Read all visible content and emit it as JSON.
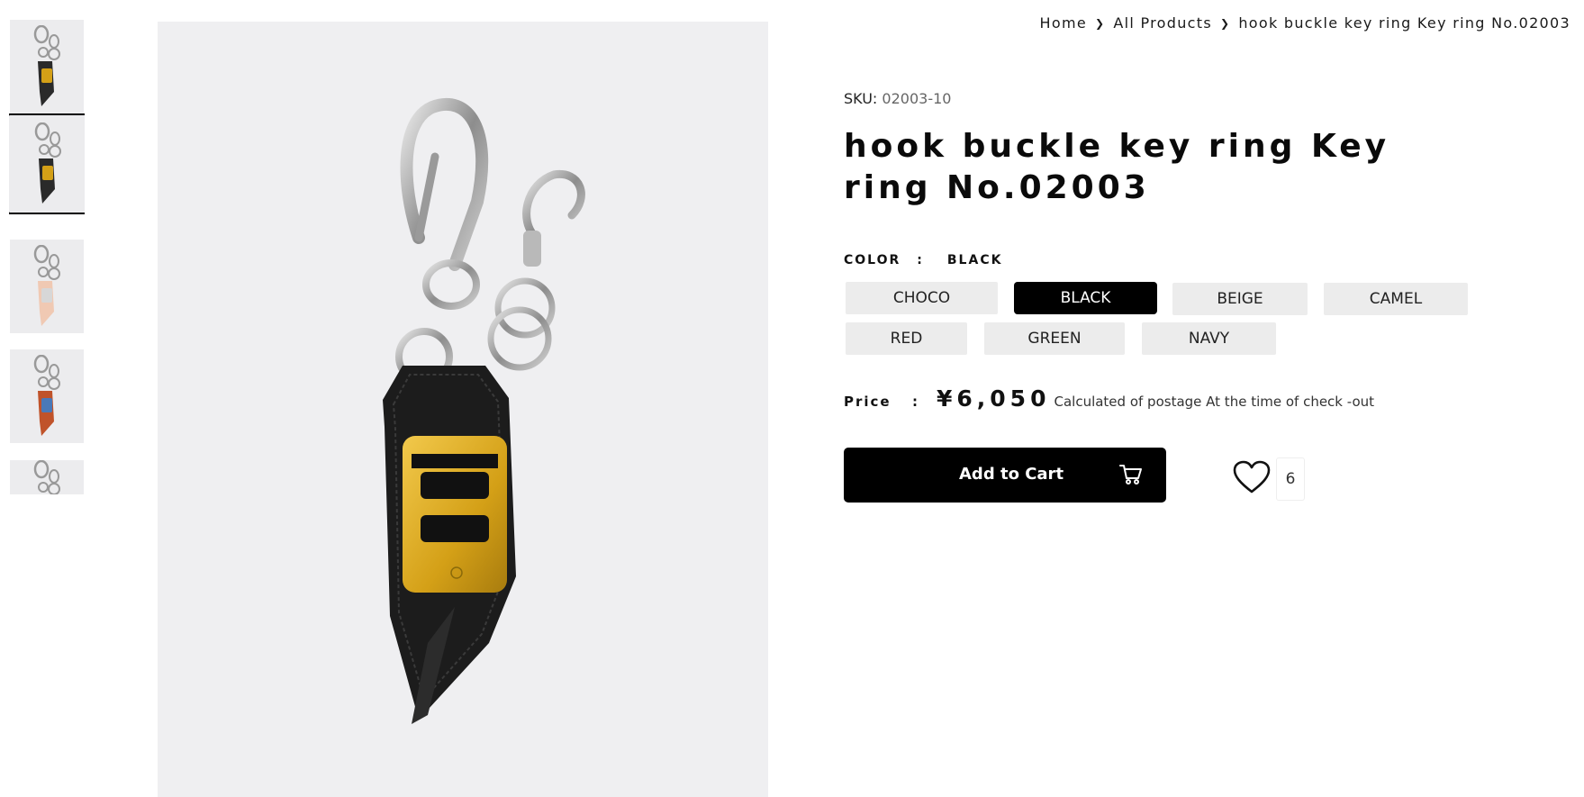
{
  "breadcrumb": {
    "home": "Home",
    "all_products": "All Products",
    "current": "hook buckle key ring Key ring No.02003"
  },
  "product": {
    "sku_label": "SKU:",
    "sku_value": "02003-10",
    "title": "hook buckle key ring Key ring No.02003",
    "color_label": "COLOR",
    "color_colon": ":",
    "color_value": "BLACK",
    "colors": [
      "CHOCO",
      "BLACK",
      "BEIGE",
      "CAMEL",
      "RED",
      "GREEN",
      "NAVY"
    ],
    "selected_color": "BLACK",
    "price_label": "Price",
    "price_colon": ":",
    "price_value": "¥6,050",
    "price_note": "Calculated of postage At the time of check -out",
    "add_to_cart": "Add to Cart",
    "favorite_count": "6"
  },
  "icons": {
    "breadcrumb_separator": "chevron-right-icon",
    "cart": "cart-icon",
    "favorite": "heart-icon"
  },
  "thumbnails": [
    {
      "strap_color": "#2a2a2a",
      "buckle_color": "#d4a017",
      "selected": false
    },
    {
      "strap_color": "#2a2a2a",
      "buckle_color": "#d4a017",
      "selected": true
    },
    {
      "strap_color": "#f0c9b3",
      "buckle_color": "#d7d7d7",
      "selected": false
    },
    {
      "strap_color": "#c0532a",
      "buckle_color": "#4a79b8",
      "selected": false
    },
    {
      "strap_color": "#2a2a2a",
      "buckle_color": "#d4a017",
      "selected": false
    }
  ],
  "colors": {
    "accent": "#000000",
    "swatch_bg": "#ececec",
    "image_bg": "#efeff1",
    "gold": "#d4a017"
  }
}
